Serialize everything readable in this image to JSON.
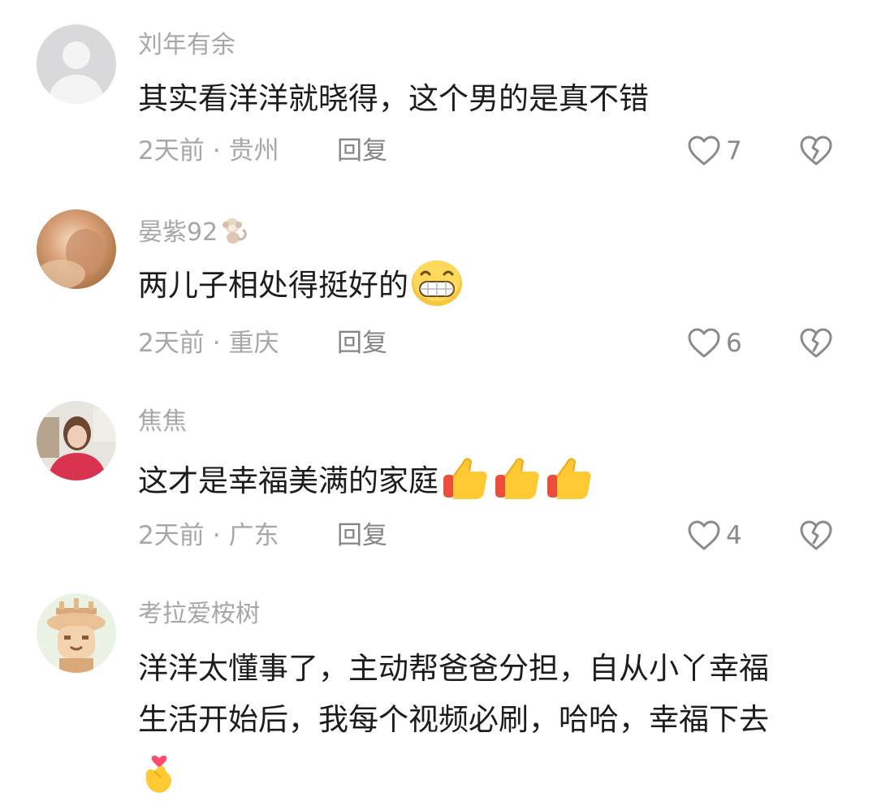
{
  "comments": [
    {
      "username": "刘年有余",
      "text": "其实看洋洋就晓得，这个男的是真不错",
      "time": "2天前",
      "separator": "·",
      "location": "贵州",
      "reply_label": "回复",
      "likes": "7",
      "avatar_icon": "default-user-avatar"
    },
    {
      "username": "晏紫92",
      "username_emoji": "monkey",
      "text": "两儿子相处得挺好的",
      "text_emoji": "grinning-face",
      "time": "2天前",
      "separator": "·",
      "location": "重庆",
      "reply_label": "回复",
      "likes": "6",
      "avatar_icon": "photo-avatar"
    },
    {
      "username": "焦焦",
      "text": "这才是幸福美满的家庭",
      "text_emoji": "thumbs-up x3",
      "time": "2天前",
      "separator": "·",
      "location": "广东",
      "reply_label": "回复",
      "likes": "4",
      "avatar_icon": "photo-avatar"
    },
    {
      "username": "考拉爱桉树",
      "text_line1": "洋洋太懂事了，主动帮爸爸分担，自从小丫幸福",
      "text_line2": "生活开始后，我每个视频必刷，哈哈，幸福下去",
      "text_emoji": "finger-heart",
      "avatar_icon": "cartoon-avatar"
    }
  ],
  "colors": {
    "username": "#a7a7ab",
    "text": "#1c1c1e",
    "meta": "#a7a7ab",
    "icon": "#8a8a8e"
  }
}
